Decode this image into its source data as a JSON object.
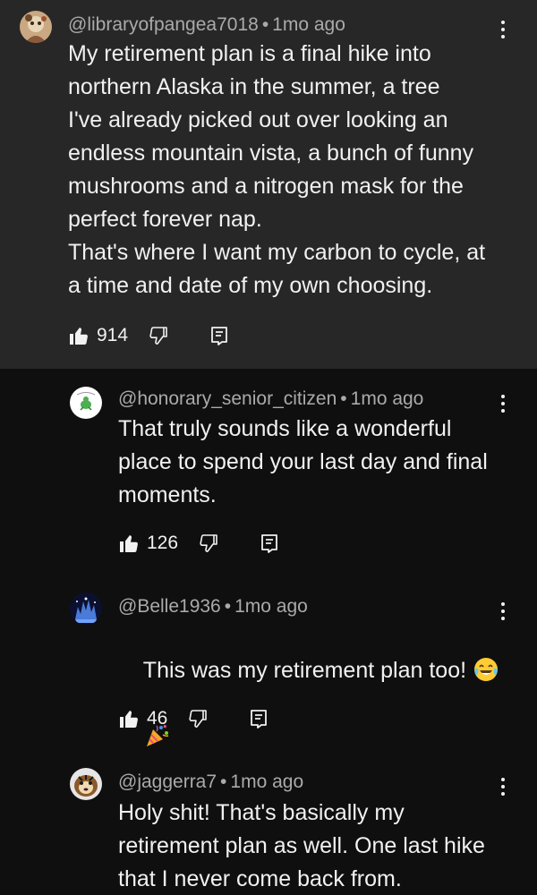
{
  "comments": [
    {
      "handle": "@libraryofpangea7018",
      "time": "1mo ago",
      "text": "My retirement plan is a final hike into\nnorthern Alaska in the summer, a tree\nI've already picked out over looking an\nendless mountain vista, a bunch of funny\nmushrooms and a nitrogen mask for the\nperfect forever nap.\nThat's where I want my carbon to cycle, at\na time and date of my own choosing.",
      "likes": "914"
    },
    {
      "handle": "@honorary_senior_citizen",
      "time": "1mo ago",
      "text": "That truly sounds like a wonderful\nplace to spend your last day and final\nmoments.",
      "likes": "126"
    },
    {
      "handle": "@Belle1936",
      "time": "1mo ago",
      "text": "This was my retirement plan too! ",
      "likes": "46"
    },
    {
      "handle": "@jaggerra7",
      "time": "1mo ago",
      "text": "Holy shit! That's basically my\nretirement plan as well. One last hike\nthat I never come back from."
    }
  ],
  "separator": "•",
  "icons": {
    "like": "thumbs-up-icon",
    "dislike": "thumbs-down-icon",
    "reply": "reply-icon",
    "more": "more-vert-icon",
    "emoji_laugh": "tears-of-joy-emoji",
    "emoji_party": "party-popper-emoji"
  },
  "colors": {
    "top_comment_bg": "#272727",
    "page_bg": "#0f0f0f",
    "meta_text": "#aaaaaa",
    "body_text": "#f1f1f1"
  }
}
